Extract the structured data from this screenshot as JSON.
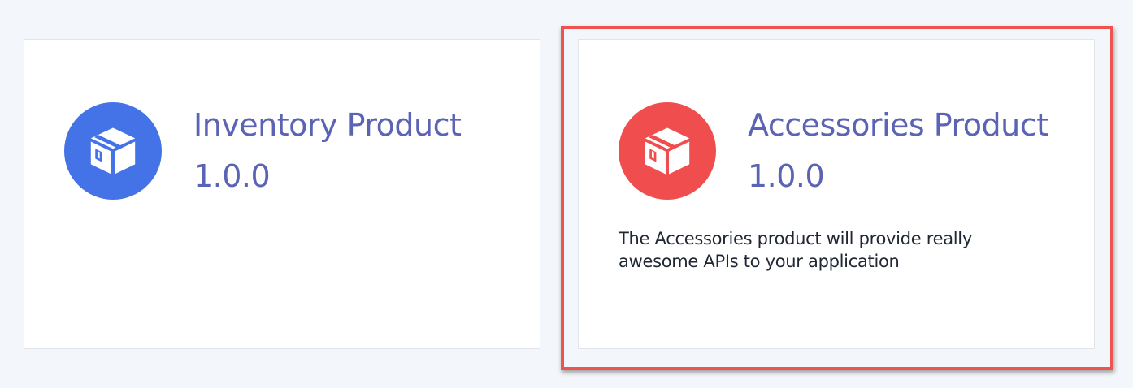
{
  "products": [
    {
      "title": "Inventory Product",
      "version": "1.0.0",
      "description": "",
      "icon": "package-icon",
      "icon_color": "#4373e6"
    },
    {
      "title": "Accessories Product",
      "version": "1.0.0",
      "description": "The Accessories product will provide really awesome APIs to your application",
      "icon": "package-icon",
      "icon_color": "#f04e4e",
      "highlighted": true
    }
  ],
  "colors": {
    "background": "#f3f6fa",
    "title_text": "#5b63b4",
    "highlight_border": "#ef5350"
  }
}
